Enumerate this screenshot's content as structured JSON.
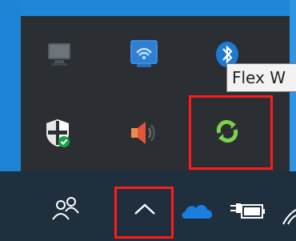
{
  "tooltip": {
    "text": "Flex W"
  },
  "tray": {
    "icons": [
      "monitor-icon",
      "wifi-network-icon",
      "bluetooth-icon",
      "defender-shield-icon",
      "speaker-volume-icon",
      "flex-sync-icon"
    ]
  },
  "taskbar": {
    "icons": [
      "people-icon",
      "show-hidden-icons-chevron-icon",
      "onedrive-cloud-icon",
      "battery-plug-icon",
      "wifi-signal-icon"
    ]
  },
  "colors": {
    "highlight": "#ff1b1b",
    "tray_bg": "#2b2f33",
    "taskbar_bg": "#1f2f3d",
    "desktop": "#1f86d8",
    "sync_green": "#7fd04a"
  }
}
